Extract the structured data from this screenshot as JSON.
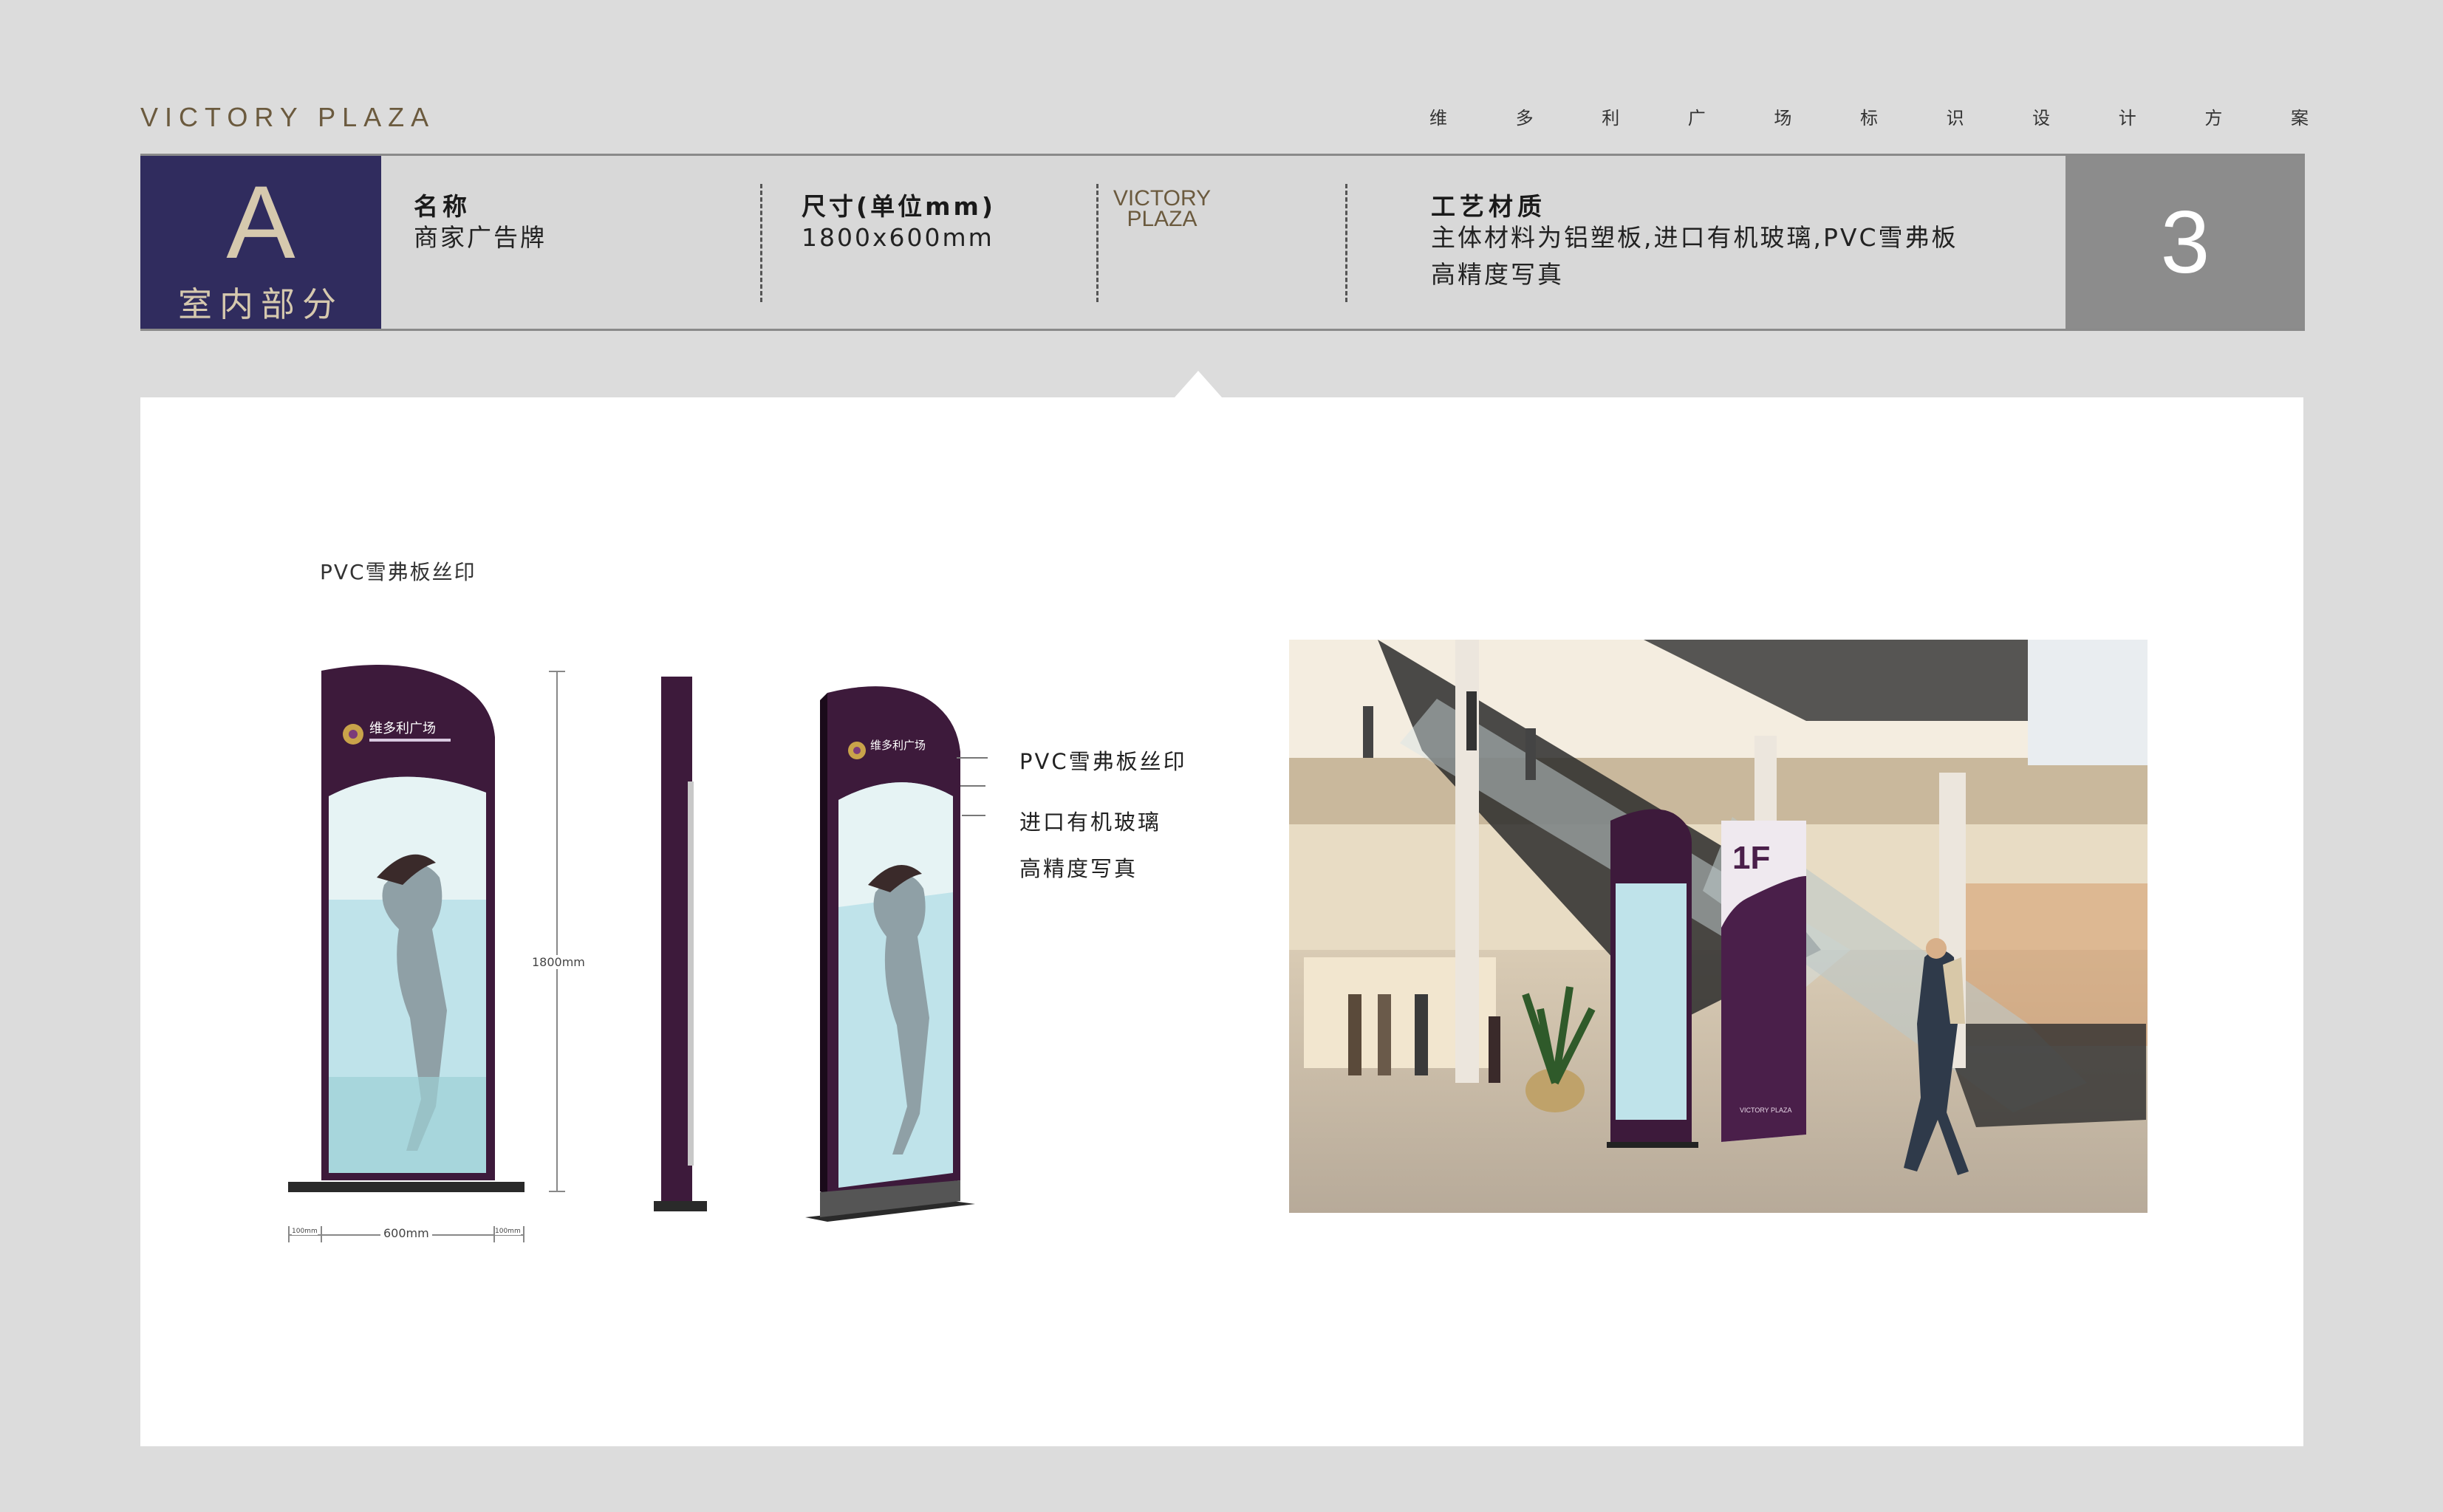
{
  "brand": "VICTORY PLAZA",
  "project_title_chars": [
    "维",
    "多",
    "利",
    "广",
    "场",
    "标",
    "识",
    "设",
    "计",
    "方",
    "案"
  ],
  "header": {
    "section_letter": "A",
    "section_name": "室内部分",
    "name_label": "名称",
    "name_value": "商家广告牌",
    "size_label": "尺寸(单位mm)",
    "size_value": "1800x600mm",
    "logo_line1": "VICTORY",
    "logo_line2": "PLAZA",
    "material_label": "工艺材质",
    "material_line1": "主体材料为铝塑板,进口有机玻璃,PVC雪弗板",
    "material_line2": "高精度写真",
    "page_number": "3"
  },
  "panel": {
    "print_label": "PVC雪弗板丝印",
    "dim_height": "1800mm",
    "dim_width": "600mm",
    "dim_side_left": "100mm",
    "dim_side_right": "100mm",
    "callouts": [
      "PVC雪弗板丝印",
      "进口有机玻璃",
      "高精度写真"
    ],
    "sign_logo_text": "维多利广场",
    "photo_floor_label": "1F",
    "photo_sign_text": "VICTORY PLAZA"
  },
  "colors": {
    "badge_bg": "#302c5e",
    "sign_purple": "#3d1a3b",
    "accent_gold": "#6b5a3e",
    "page_box": "#8c8c8c"
  }
}
